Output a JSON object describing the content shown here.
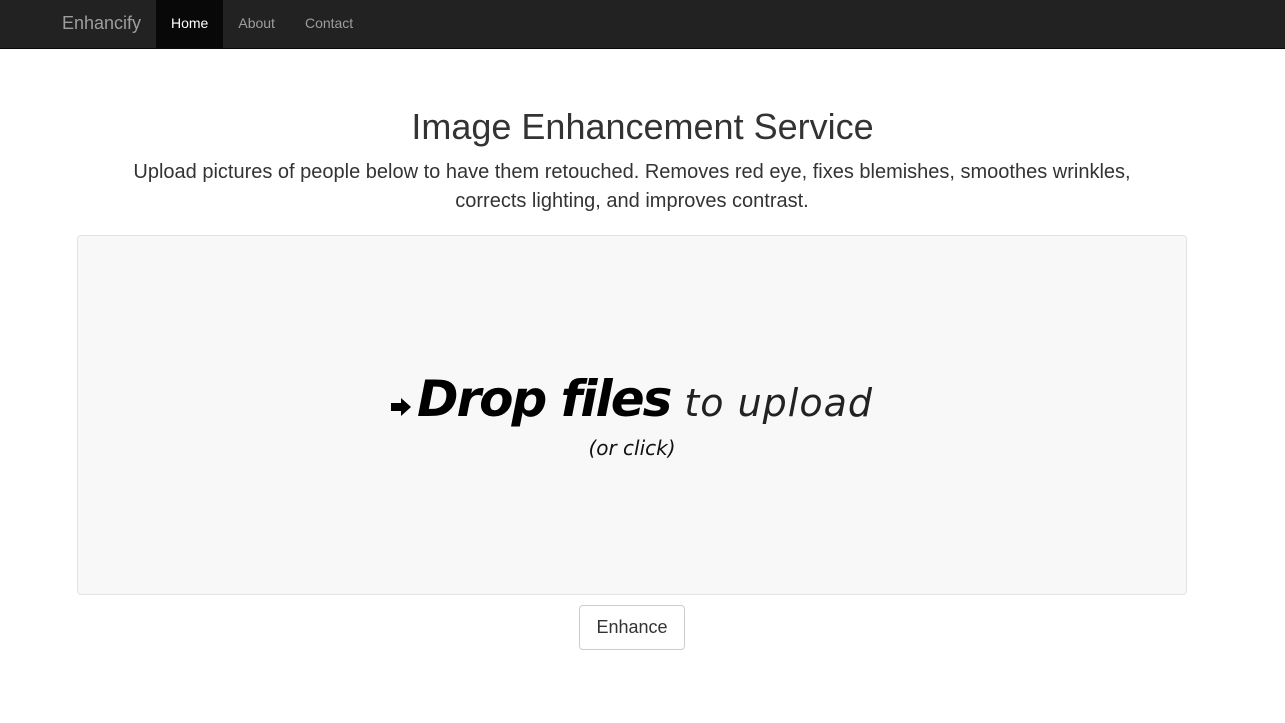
{
  "navbar": {
    "brand": "Enhancify",
    "items": [
      {
        "label": "Home",
        "active": true
      },
      {
        "label": "About",
        "active": false
      },
      {
        "label": "Contact",
        "active": false
      }
    ]
  },
  "main": {
    "title": "Image Enhancement Service",
    "lead": "Upload pictures of people below to have them retouched. Removes red eye, fixes blemishes, smoothes wrinkles, corrects lighting, and improves contrast."
  },
  "dropzone": {
    "strong_text": "Drop files",
    "light_text": "to upload",
    "sub_text": "(or click)",
    "icon": "arrow-right-icon"
  },
  "actions": {
    "enhance_label": "Enhance"
  },
  "colors": {
    "navbar_bg": "#222222",
    "nav_active_bg": "#080808",
    "dropzone_bg": "#f8f8f8"
  }
}
